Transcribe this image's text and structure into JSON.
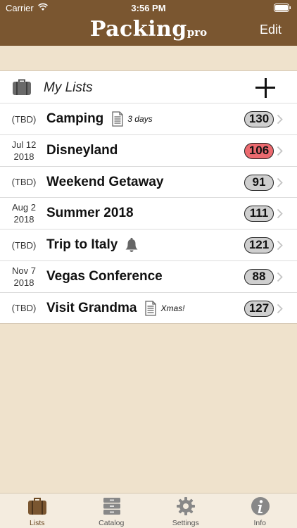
{
  "status": {
    "carrier": "Carrier",
    "time": "3:56 PM"
  },
  "header": {
    "title": "Packing",
    "title_suffix": "pro",
    "edit_label": "Edit"
  },
  "lists_section": {
    "title": "My Lists"
  },
  "lists": [
    {
      "date": "(TBD)",
      "name": "Camping",
      "note": "3 days",
      "has_note": true,
      "has_bell": false,
      "count": "130",
      "count_alert": false
    },
    {
      "date": "Jul 12\n2018",
      "name": "Disneyland",
      "note": "",
      "has_note": false,
      "has_bell": false,
      "count": "106",
      "count_alert": true
    },
    {
      "date": "(TBD)",
      "name": "Weekend Getaway",
      "note": "",
      "has_note": false,
      "has_bell": false,
      "count": "91",
      "count_alert": false
    },
    {
      "date": "Aug 2\n2018",
      "name": "Summer 2018",
      "note": "",
      "has_note": false,
      "has_bell": false,
      "count": "111",
      "count_alert": false
    },
    {
      "date": "(TBD)",
      "name": "Trip to Italy",
      "note": "",
      "has_note": false,
      "has_bell": true,
      "count": "121",
      "count_alert": false
    },
    {
      "date": "Nov 7\n2018",
      "name": "Vegas Conference",
      "note": "",
      "has_note": false,
      "has_bell": false,
      "count": "88",
      "count_alert": false
    },
    {
      "date": "(TBD)",
      "name": "Visit Grandma",
      "note": "Xmas!",
      "has_note": true,
      "has_bell": false,
      "count": "127",
      "count_alert": false
    }
  ],
  "tabs": [
    {
      "label": "Lists",
      "icon": "suitcase-icon",
      "active": true
    },
    {
      "label": "Catalog",
      "icon": "catalog-icon",
      "active": false
    },
    {
      "label": "Settings",
      "icon": "gear-icon",
      "active": false
    },
    {
      "label": "Info",
      "icon": "info-icon",
      "active": false
    }
  ],
  "colors": {
    "header": "#7a5630",
    "background": "#efe2cc",
    "badge": "#cfcfcf",
    "badge_alert": "#ec6a6f",
    "tab_active": "#6c4a24"
  }
}
